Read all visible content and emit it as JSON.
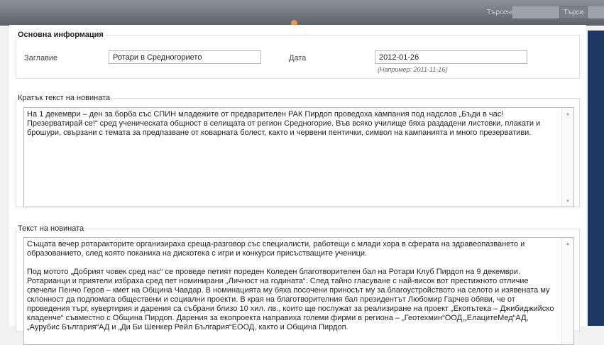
{
  "header": {
    "search_label": "Търсене:",
    "search_value": "",
    "search_button": "Търси"
  },
  "basic_info": {
    "legend": "Основна информация",
    "title_label": "Заглавие",
    "title_value": "Ротари в Средногорието",
    "date_label": "Дата",
    "date_value": "2012-01-26",
    "date_hint": "(Например: 2011-11-16)"
  },
  "short_text": {
    "legend": "Кратък текст на новината",
    "paragraphs": [
      "На 1 декември – ден за борба със СПИН младежите от предварителен РАК Пирдоп проведоха кампания под надслов „Бъди в час! Презерватирай се!“ сред ученическата общност в селищата от регион Средногорие. Във всяко училище бяха раздадени листовки, плакати и брошури, свързани с темата за предпазване от коварната болест, както и червени пентички, символ на кампанията и много презервативи."
    ]
  },
  "full_text": {
    "legend": "Текст на новината",
    "paragraphs": [
      "Същата вечер ротаракторите организираха среща-разговор със специалисти, работещи с млади хора в сферата на здравеопазването и образованието, след която поканиха на дискотека с игри и конкурси присъстващите ученици.",
      "Под мотото „Добрият човек сред нас“ се проведе петият пореден Коледен благотворителен бал на Ротари Клуб Пирдоп на 9 декември. Ротарианци и приятели избраха сред пет номинирани „Личност на годината“. След тайно гласуване с най-висок вот престижното отличие спечели  Пенчо Геров – кмет на Община Чавдар. В номинацията му бяха посочени приносът му за благоустройството на селото и изявената му склонност да подпомага обществени и социални проекти. В края на благотворителния бал президентът Любомир Гарчев обяви, че от проведения търг, кувертирия и дарения са събрани близо 10 хил. лв., които ще послужат за реализиране на проект „Екопътека – Джибиджийско кладенче“ съвместно с Община Пирдоп. Дарения за екопроекта направиха големи фирми в региона – „Геотехмин“ООД,„ЕлацитеМед“АД, „Аурубис България“АД и „Ди Би Шенкер Рейл България“ЕООД, както и Община Пирдоп."
    ]
  },
  "icons": {
    "scroll_up": "scroll-up-arrow",
    "scroll_down": "scroll-down-arrow"
  }
}
